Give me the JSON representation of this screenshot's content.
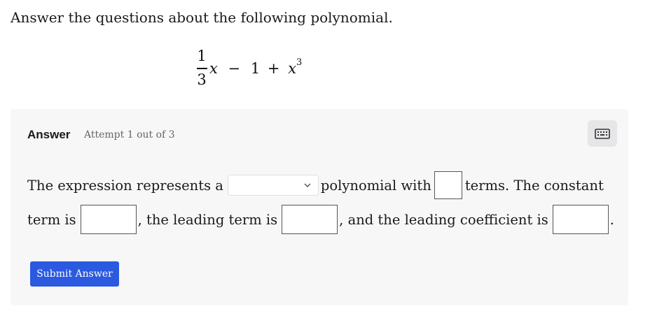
{
  "question": {
    "text": "Answer the questions about the following polynomial."
  },
  "expression": {
    "fraction_numerator": "1",
    "fraction_denominator": "3",
    "x": "x",
    "minus": "−",
    "one": "1",
    "plus": "+",
    "x2": "x",
    "exponent": "3"
  },
  "answer": {
    "title": "Answer",
    "attempt": "Attempt 1 out of 3",
    "keyboard_icon": "keyboard-icon",
    "sentence": {
      "part1": "The expression represents a",
      "part2": "polynomial with",
      "part3": "terms. The constant",
      "part4": "term is",
      "part5": ", the leading term is",
      "part6": ", and the leading coefficient is",
      "part7": "."
    },
    "select_value": "",
    "inputs": {
      "num_terms": "",
      "constant_term": "",
      "leading_term": "",
      "leading_coefficient": ""
    },
    "submit_label": "Submit Answer"
  },
  "colors": {
    "accent": "#2b59e0",
    "panel_bg": "#f7f7f8"
  }
}
